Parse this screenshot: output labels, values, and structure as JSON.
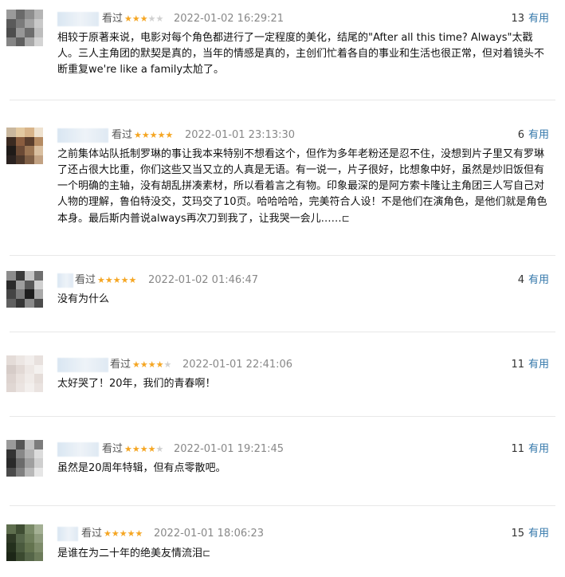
{
  "useful_label": "有用",
  "watched_label": "看过",
  "colors": {
    "star_on": "#f5a623",
    "star_off": "#d0d0d0",
    "link": "#3377aa"
  },
  "comments": [
    {
      "status": "看过",
      "rating": 3,
      "time": "2022-01-02 16:29:21",
      "useful_count": "13",
      "text": "相较于原著来说，电影对每个角色都进行了一定程度的美化，结尾的\"After all this time? Always\"太戳人。三人主角团的默契是真的，当年的情感是真的，主创们忙着各自的事业和生活也很正常，但对着镜头不断重复we're like a family太尬了。"
    },
    {
      "status": "看过",
      "rating": 5,
      "time": "2022-01-01 23:13:30",
      "useful_count": "6",
      "text": "之前集体站队抵制罗琳的事让我本来特别不想看这个，但作为多年老粉还是忍不住，没想到片子里又有罗琳了还占很大比重，你们这些又当又立的人真是无语。有一说一，片子很好，比想象中好，虽然是炒旧饭但有一个明确的主轴，没有胡乱拼凑素材，所以看着言之有物。印象最深的是阿方索卡隆让主角团三人写自己对人物的理解，鲁伯特没交，艾玛交了10页。哈哈哈哈，完美符合人设！不是他们在演角色，是他们就是角色本身。最后斯内普说always再次刀到我了，让我哭一会儿……",
      "more": "⊏"
    },
    {
      "status": "看过",
      "rating": 5,
      "time": "2022-01-02 01:46:47",
      "useful_count": "4",
      "text": "没有为什么"
    },
    {
      "status": "看过",
      "rating": 4,
      "time": "2022-01-01 22:41:06",
      "useful_count": "11",
      "text": "太好哭了！20年，我们的青春啊！"
    },
    {
      "status": "看过",
      "rating": 4,
      "time": "2022-01-01 19:21:45",
      "useful_count": "11",
      "text": "虽然是20周年特辑，但有点零散吧。"
    },
    {
      "status": "看过",
      "rating": 5,
      "time": "2022-01-01 18:06:23",
      "useful_count": "15",
      "text": "是谁在为二十年的绝美友情流泪",
      "more": "⊏"
    }
  ]
}
